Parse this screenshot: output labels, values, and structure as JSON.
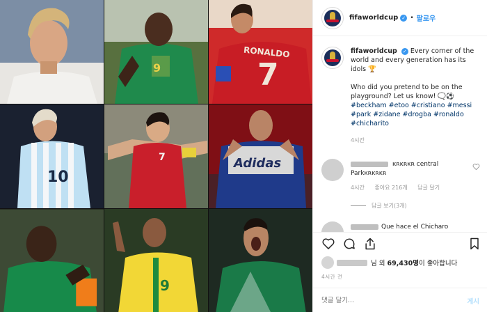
{
  "header": {
    "username": "fifaworldcup",
    "verified_mark": "✓",
    "separator": "•",
    "follow_label": "팔로우"
  },
  "caption": {
    "username": "fifaworldcup",
    "text_1": "Every corner of the world and every generation has its idols 🏆",
    "text_2": "Who did you pretend to be on the playground? Let us know! 🗨️⚽",
    "tags": "#beckham #etoo #cristiano #messi #park #zidane #drogba #ronaldo #chicharito",
    "time": "4시간"
  },
  "comments": [
    {
      "text": "ĸʀĸʀĸʀ central Parkĸʀĸʀĸʀ",
      "time": "4시간",
      "likes": "좋아요 216개",
      "reply": "답글 달기",
      "view_replies": "답글 보기(3개)"
    },
    {
      "text": "Que hace el Chicharo"
    }
  ],
  "actions": {
    "icons": [
      "heart-icon",
      "comment-icon",
      "share-icon",
      "bookmark-icon"
    ],
    "likes_prefix": "님 외",
    "likes_count": "69,430명",
    "likes_suffix": "이 좋아합니다",
    "time_ago": "4시간 전",
    "add_comment_placeholder": "댓글 달기...",
    "post_label": "게시"
  },
  "grid": {
    "jersey_labels": [
      "9",
      "RONALDO",
      "7",
      "10",
      "7",
      "Adidas",
      "9"
    ]
  }
}
